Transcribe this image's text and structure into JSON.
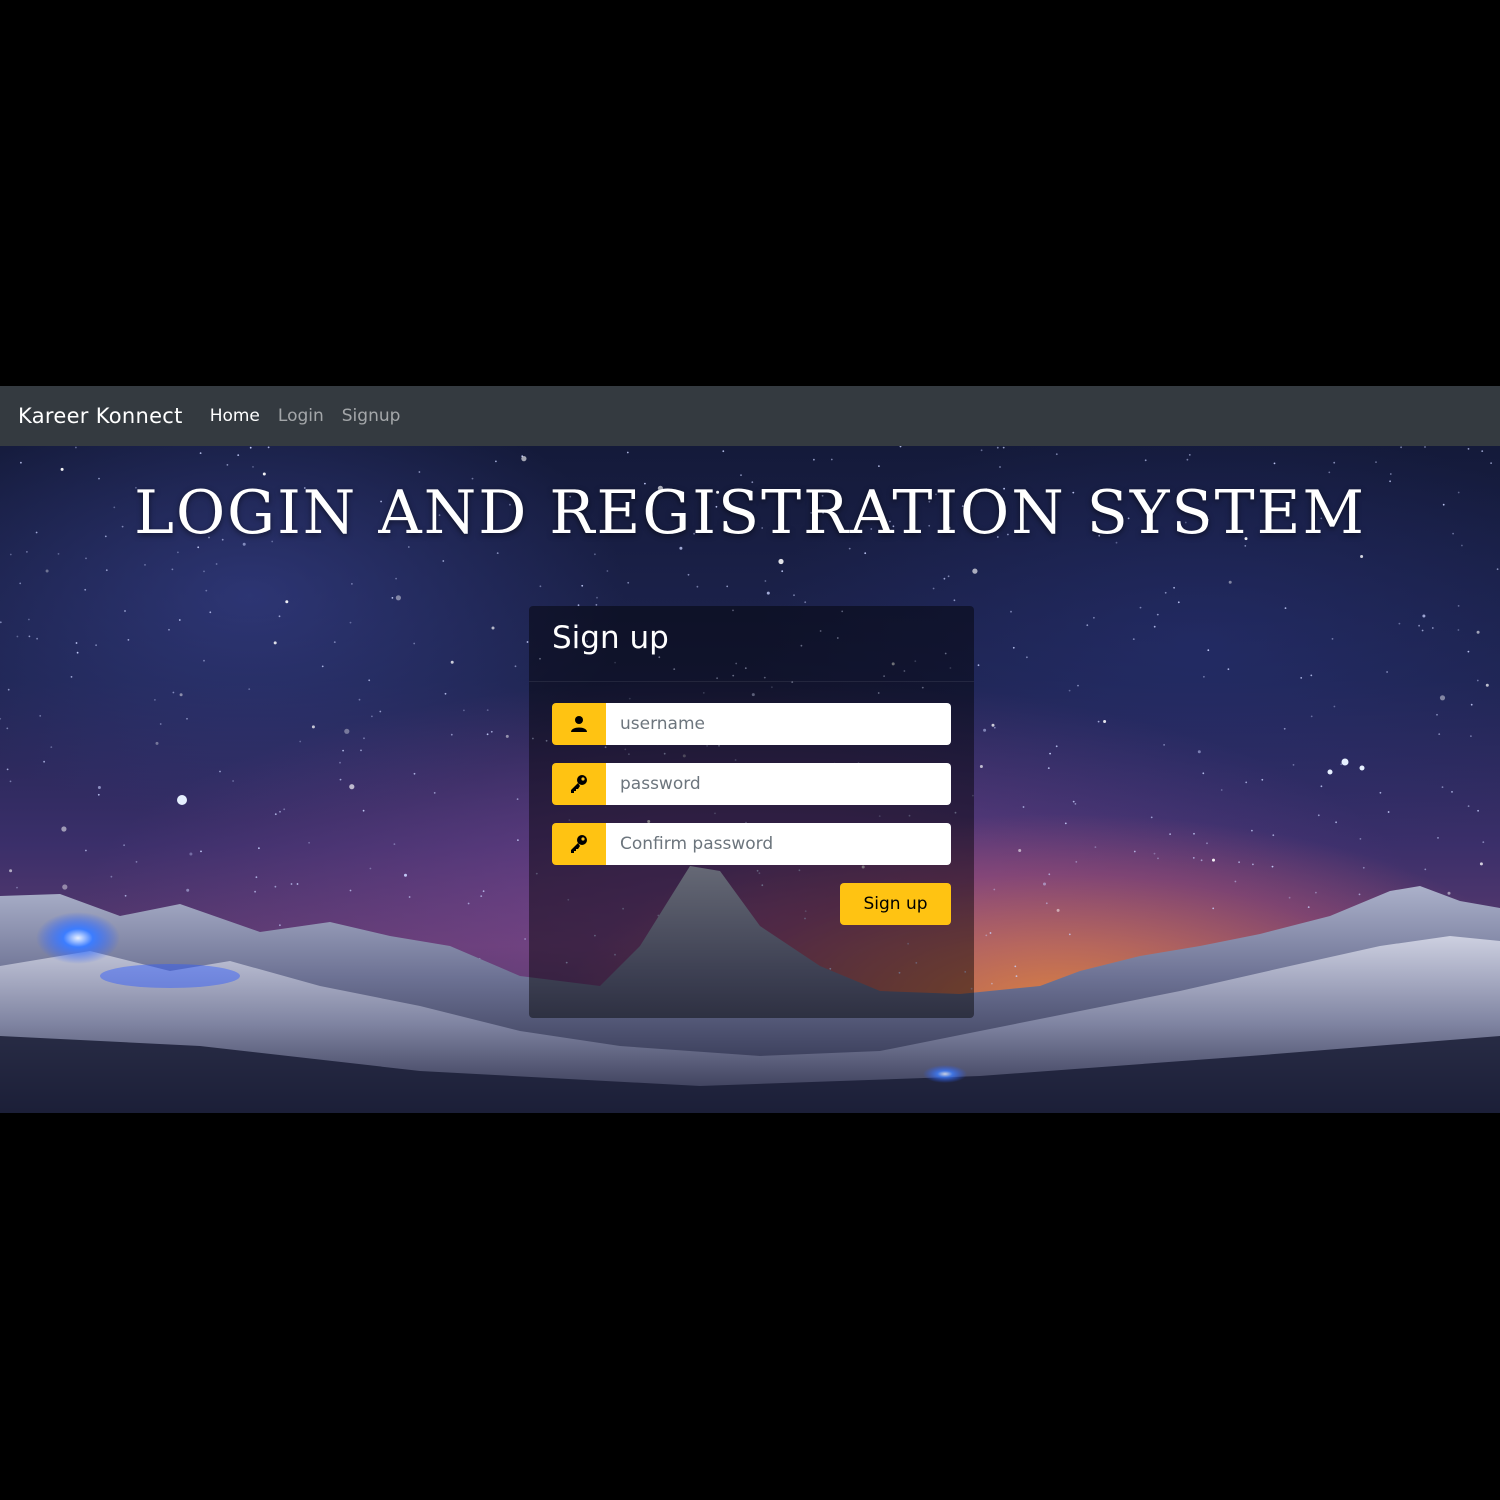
{
  "navbar": {
    "brand": "Kareer Konnect",
    "links": [
      {
        "label": "Home",
        "active": true
      },
      {
        "label": "Login",
        "active": false
      },
      {
        "label": "Signup",
        "active": false
      }
    ]
  },
  "hero": {
    "headline": "LOGIN AND REGISTRATION SYSTEM"
  },
  "signup_form": {
    "title": "Sign up",
    "fields": {
      "username": {
        "value": "",
        "placeholder": "username",
        "icon": "user-icon"
      },
      "password": {
        "value": "",
        "placeholder": "password",
        "icon": "key-icon"
      },
      "confirm_password": {
        "value": "",
        "placeholder": "Confirm password",
        "icon": "key-icon"
      }
    },
    "submit_label": "Sign up"
  },
  "colors": {
    "navbar_bg": "#343a40",
    "accent": "#ffc312",
    "card_bg": "rgba(0,0,0,0.45)"
  }
}
